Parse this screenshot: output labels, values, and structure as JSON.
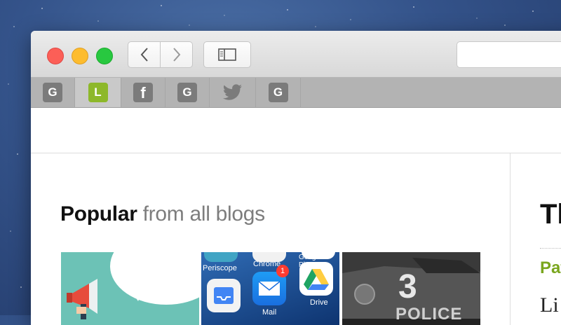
{
  "toolbar": {
    "back_label": "‹",
    "forward_label": "›"
  },
  "favorites": [
    {
      "label": "G",
      "icon": "gmail-g-icon",
      "color": "#7b7b7b"
    },
    {
      "label": "L",
      "icon": "lifehacker-l-icon",
      "color": "#8db82a"
    },
    {
      "label": "f",
      "icon": "facebook-icon",
      "color": "#7b7b7b"
    },
    {
      "label": "G",
      "icon": "gmail-g-icon",
      "color": "#7b7b7b"
    },
    {
      "label": "",
      "icon": "twitter-bird-icon",
      "color": "#7b7b7b"
    },
    {
      "label": "G",
      "icon": "gmail-g-icon",
      "color": "#7b7b7b"
    }
  ],
  "main": {
    "heading_bold": "Popular",
    "heading_rest": "from all blogs",
    "thumbs": [
      {
        "name": "megaphone-illustration"
      },
      {
        "name": "ios-homescreen",
        "apps": [
          "Periscope",
          "Chrome",
          "Google Photos",
          "Mail",
          "Drive"
        ],
        "badge": "1"
      },
      {
        "name": "police-car",
        "number": "3",
        "text": "POLICE"
      }
    ]
  },
  "right": {
    "title": "Th",
    "author": "Pat",
    "body": "Li"
  },
  "colors": {
    "accent_green": "#7aa61e",
    "desktop_blue": "#34538a"
  }
}
